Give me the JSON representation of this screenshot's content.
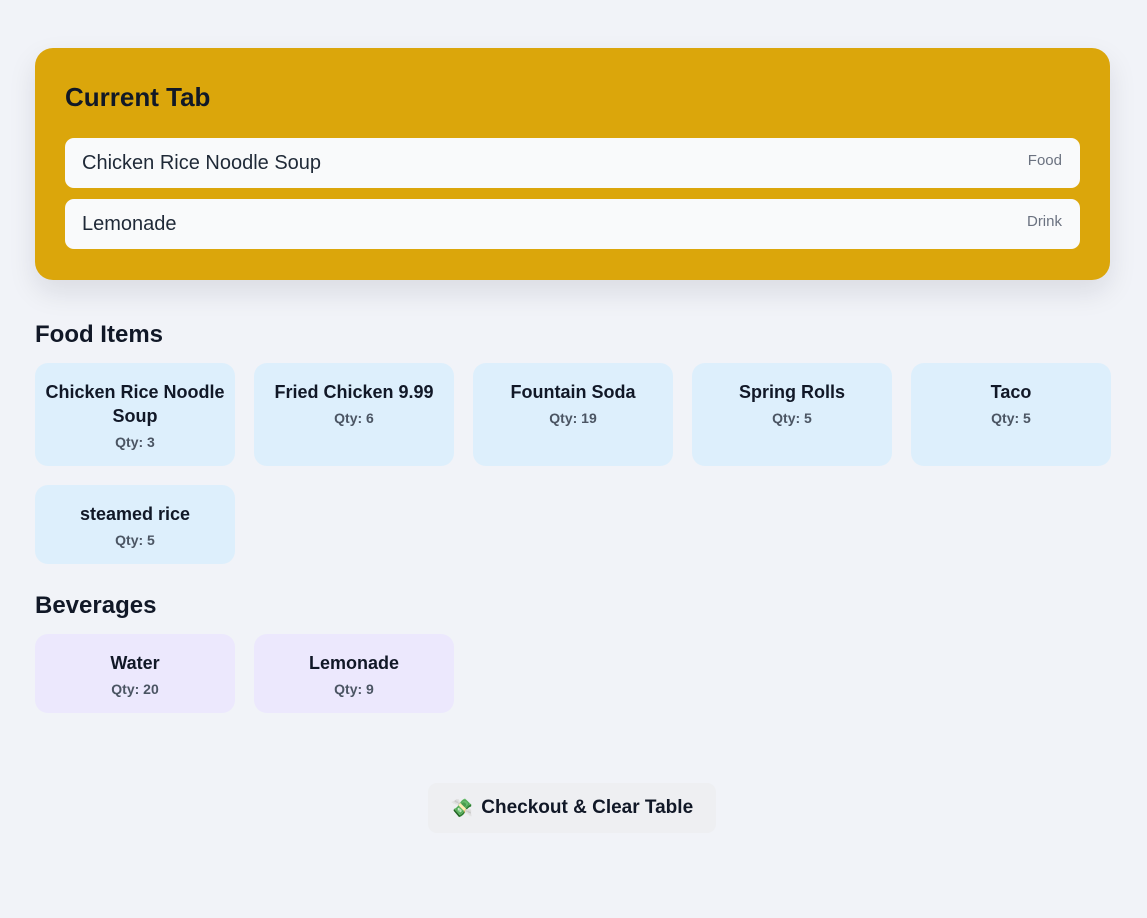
{
  "current_tab": {
    "title": "Current Tab",
    "items": [
      {
        "name": "Chicken Rice Noodle Soup",
        "type": "Food"
      },
      {
        "name": "Lemonade",
        "type": "Drink"
      }
    ]
  },
  "food": {
    "title": "Food Items",
    "items": [
      {
        "name": "Chicken Rice Noodle Soup",
        "qty": "Qty: 3"
      },
      {
        "name": "Fried Chicken 9.99",
        "qty": "Qty: 6"
      },
      {
        "name": "Fountain Soda",
        "qty": "Qty: 19"
      },
      {
        "name": "Spring Rolls",
        "qty": "Qty: 5"
      },
      {
        "name": "Taco",
        "qty": "Qty: 5"
      },
      {
        "name": "steamed rice",
        "qty": "Qty: 5"
      }
    ]
  },
  "beverages": {
    "title": "Beverages",
    "items": [
      {
        "name": "Water",
        "qty": "Qty: 20"
      },
      {
        "name": "Lemonade",
        "qty": "Qty: 9"
      }
    ]
  },
  "checkout": {
    "icon": "money-icon",
    "icon_glyph": "💸",
    "label": "Checkout & Clear Table"
  },
  "colors": {
    "tab_panel": "#dba60b",
    "food_card": "#ddeffc",
    "beverage_card": "#ece8fd",
    "page_background": "#f1f3f8"
  }
}
